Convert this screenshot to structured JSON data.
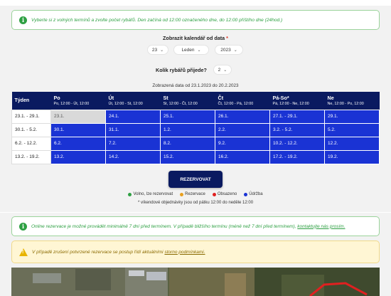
{
  "info_top": "Vyberte si z volných termínů a zvolte počet rybářů. Den začíná od 12:00 označeného dne, do 12:00 příštího dne (24hod.)",
  "calendar_label": "Zobrazit kalendář od data",
  "required_mark": "*",
  "date_select": {
    "day": "23",
    "month": "Leden",
    "year": "2023"
  },
  "fishers_label": "Kolik rybářů přijede?",
  "fishers_select": "2",
  "range_text": "Zobrazená data od 23.1.2023 do 20.2.2023",
  "table": {
    "week_header": "Týden",
    "days": [
      {
        "day": "Po",
        "time": "Po, 12:00 - Út, 12:00"
      },
      {
        "day": "Út",
        "time": "Út, 12:00 - St, 12:00"
      },
      {
        "day": "St",
        "time": "St, 12:00 - Čt, 12:00"
      },
      {
        "day": "Čt",
        "time": "Čt, 12:00 - Pá, 12:00"
      },
      {
        "day": "Pá-So*",
        "time": "Pá, 12:00 - Ne, 12:00"
      },
      {
        "day": "Ne",
        "time": "Ne, 12:00 - Po, 12:00"
      }
    ],
    "rows": [
      {
        "week": "23.1. - 29.1.",
        "cells": [
          "23.1.",
          "24.1.",
          "25.1.",
          "26.1.",
          "27.1. - 29.1.",
          "29.1."
        ]
      },
      {
        "week": "30.1. - 5.2.",
        "cells": [
          "30.1.",
          "31.1.",
          "1.2.",
          "2.2.",
          "3.2. - 5.2.",
          "5.2."
        ]
      },
      {
        "week": "6.2. - 12.2.",
        "cells": [
          "6.2.",
          "7.2.",
          "8.2.",
          "9.2.",
          "10.2. - 12.2.",
          "12.2."
        ]
      },
      {
        "week": "13.2. - 19.2.",
        "cells": [
          "13.2.",
          "14.2.",
          "15.2.",
          "16.2.",
          "17.2. - 19.2.",
          "19.2."
        ]
      }
    ]
  },
  "reserve_button": "REZERVOVAT",
  "legend": [
    {
      "label": "Volno, lze rezervovat",
      "color": "#2ea043"
    },
    {
      "label": "Rezervace",
      "color": "#e8a020"
    },
    {
      "label": "Obsazeno",
      "color": "#e02020"
    },
    {
      "label": "Údržba",
      "color": "#1a33d4"
    }
  ],
  "weekend_note": "* víkendové objednávky jsou od pátku 12:00 do neděle 12:00",
  "info_online": {
    "text": "Online rezervace je možné provádět minimálně 7 dní před termínem. V případě bližšího termínu (méně než 7 dní před termínem), ",
    "link": "kontaktujte nás prosím."
  },
  "warning": {
    "text": "V případě zrušení potvrzené rezervace se postup řídí aktuálními ",
    "link": "storno podmínkami."
  },
  "colors": {
    "navy": "#0a1a60",
    "blue": "#1a33d4",
    "green": "#2ea043"
  }
}
